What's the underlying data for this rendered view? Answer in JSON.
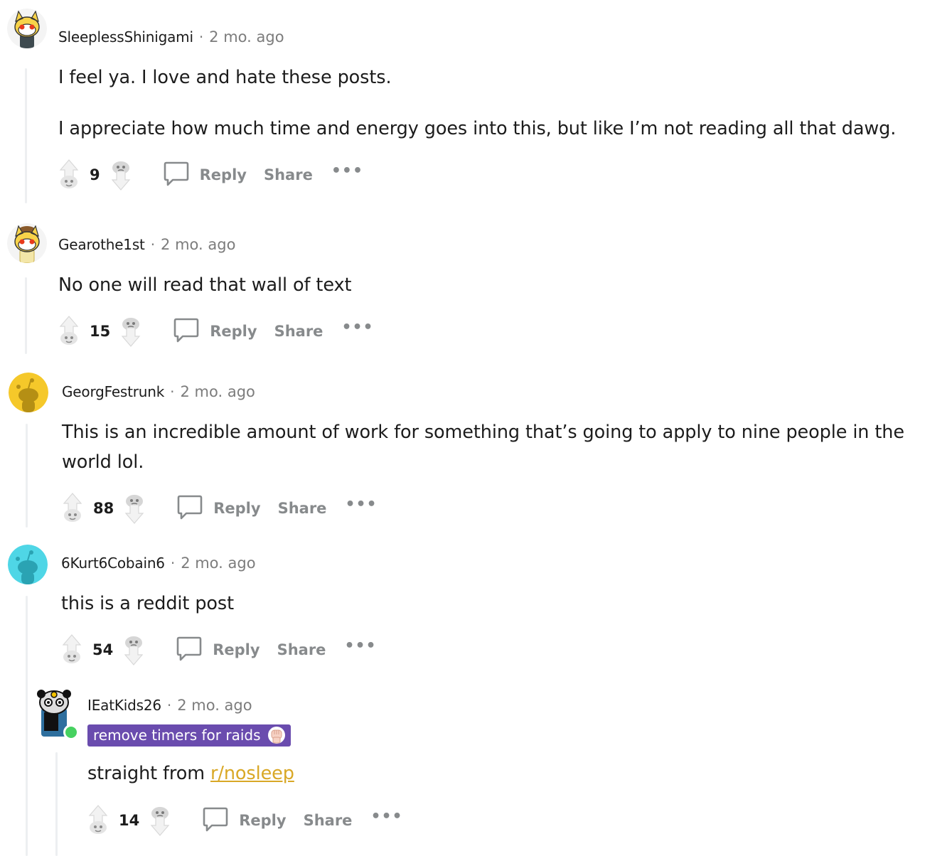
{
  "labels": {
    "reply": "Reply",
    "share": "Share",
    "more": "•••",
    "separator": "·"
  },
  "colors": {
    "flair_bg": "#6a4cae",
    "link": "#d9a826",
    "muted": "#878a8c",
    "online": "#46d160"
  },
  "comments": [
    {
      "username": "SleeplessShinigami",
      "time": "2 mo. ago",
      "avatar": "shiba-snoo-avatar",
      "paragraphs": [
        "I feel ya. I love and hate these posts.",
        "I appreciate how much time and energy goes into this, but like I’m not reading all that dawg."
      ],
      "score": "9"
    },
    {
      "username": "Gearothe1st",
      "time": "2 mo. ago",
      "avatar": "shiba-snoo-avatar",
      "paragraphs": [
        "No one will read that wall of text"
      ],
      "score": "15"
    },
    {
      "username": "GeorgFestrunk",
      "time": "2 mo. ago",
      "avatar": "yellow-snoo-avatar",
      "paragraphs": [
        "This is an incredible amount of work for something that’s going to apply to nine people in the world lol."
      ],
      "score": "88"
    },
    {
      "username": "6Kurt6Cobain6",
      "time": "2 mo. ago",
      "avatar": "cyan-snoo-avatar",
      "paragraphs": [
        "this is a reddit post"
      ],
      "score": "54"
    },
    {
      "username": "IEatKids26",
      "time": "2 mo. ago",
      "avatar": "robot-snoo-avatar",
      "flair": "remove timers for raids",
      "body_prefix": "straight from ",
      "body_link": "r/nosleep",
      "score": "14"
    }
  ]
}
